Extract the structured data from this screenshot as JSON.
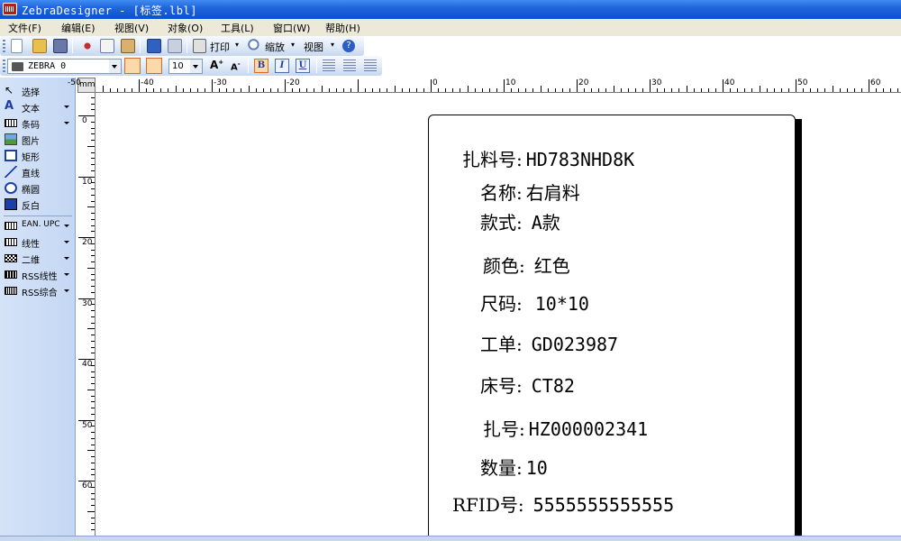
{
  "window": {
    "title": "ZebraDesigner - [标签.lbl]"
  },
  "menu": {
    "items": [
      "文件(F)",
      "编辑(E)",
      "视图(V)",
      "对象(O)",
      "工具(L)",
      "窗口(W)",
      "帮助(H)"
    ]
  },
  "toolbar": {
    "print_label": "打印",
    "zoom_label": "缩放",
    "view_label": "视图",
    "font_name": "ZEBRA 0",
    "font_size": "10",
    "bold": "B",
    "italic": "I",
    "underline": "U"
  },
  "toolbox": {
    "items": [
      "选择",
      "文本",
      "条码",
      "图片",
      "矩形",
      "直线",
      "椭圆",
      "反白",
      "EAN. UPC",
      "线性",
      "二维",
      "RSS线性",
      "RSS综合"
    ]
  },
  "ruler": {
    "unit": "mm",
    "h_labels": [
      "-50",
      "-40",
      "-30",
      "-20",
      "0",
      "10",
      "20",
      "30",
      "40",
      "50",
      "60"
    ],
    "v_labels": [
      "0",
      "10",
      "20",
      "30",
      "40",
      "50",
      "60"
    ]
  },
  "label": {
    "fields": [
      {
        "name": "扎料号:",
        "value": "HD783NHD8K"
      },
      {
        "name": "名称:",
        "value": "右肩料"
      },
      {
        "name": "款式:",
        "value": "A款"
      },
      {
        "name": "颜色:",
        "value": "红色"
      },
      {
        "name": "尺码:",
        "value": "10*10"
      },
      {
        "name": "工单:",
        "value": "GD023987"
      },
      {
        "name": "床号:",
        "value": "CT82"
      },
      {
        "name": "扎号:",
        "value": "HZ000002341"
      },
      {
        "name": "数量:",
        "value": "10"
      },
      {
        "name": "RFID号:",
        "value": "5555555555555"
      }
    ]
  }
}
